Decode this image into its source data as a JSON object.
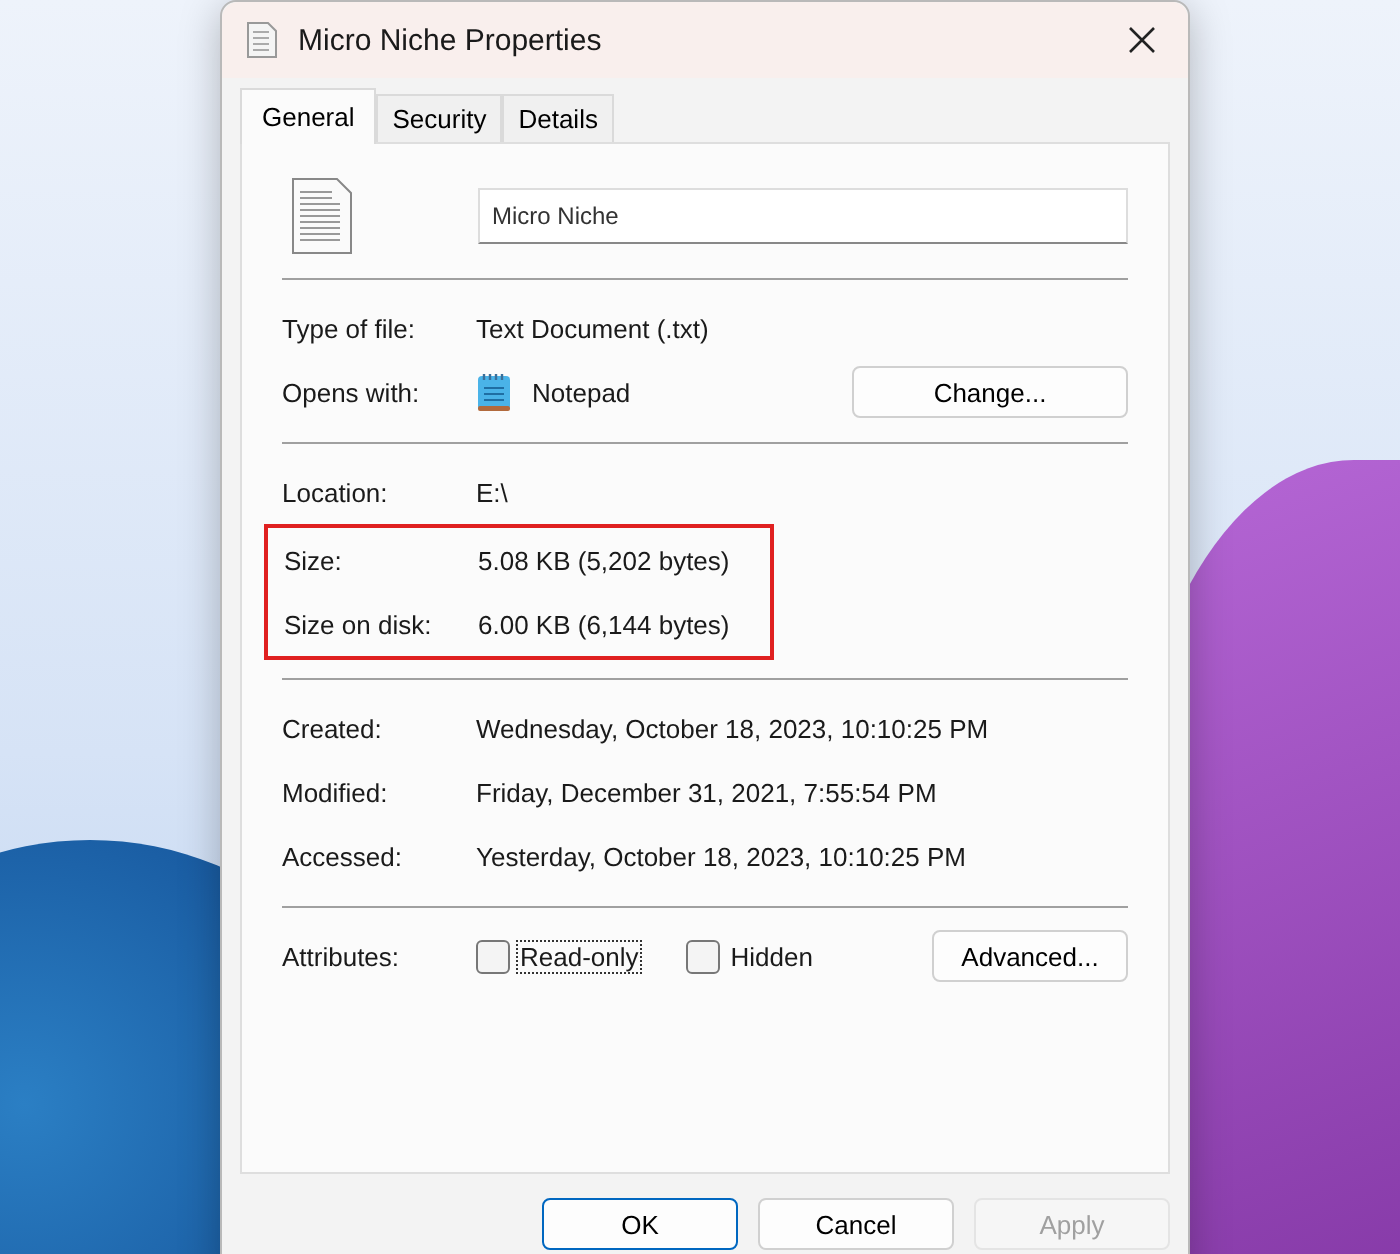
{
  "window": {
    "title": "Micro Niche Properties"
  },
  "tabs": [
    {
      "label": "General",
      "selected": true
    },
    {
      "label": "Security",
      "selected": false
    },
    {
      "label": "Details",
      "selected": false
    }
  ],
  "file_name": {
    "value": "Micro Niche"
  },
  "type_rows": [
    {
      "label": "Type of file:",
      "value": "Text Document (.txt)"
    }
  ],
  "opens_with": {
    "label": "Opens with:",
    "app": "Notepad",
    "button": "Change..."
  },
  "location_rows": [
    {
      "label": "Location:",
      "value": "E:\\"
    }
  ],
  "size_group": {
    "highlighted": true,
    "rows": [
      {
        "label": "Size:",
        "value": "5.08 KB (5,202 bytes)"
      },
      {
        "label": "Size on disk:",
        "value": "6.00 KB (6,144 bytes)"
      }
    ]
  },
  "date_rows": [
    {
      "label": "Created:",
      "value": "Wednesday, October 18, 2023, 10:10:25 PM"
    },
    {
      "label": "Modified:",
      "value": "Friday, December 31, 2021, 7:55:54 PM"
    },
    {
      "label": "Accessed:",
      "value": "Yesterday, October 18, 2023, 10:10:25 PM"
    }
  ],
  "attributes": {
    "label": "Attributes:",
    "checkboxes": [
      {
        "label": "Read-only",
        "checked": false,
        "focused": true
      },
      {
        "label": "Hidden",
        "checked": false,
        "focused": false
      }
    ],
    "button": "Advanced..."
  },
  "buttons": [
    {
      "label": "OK",
      "default": true,
      "disabled": false
    },
    {
      "label": "Cancel",
      "default": false,
      "disabled": false
    },
    {
      "label": "Apply",
      "default": false,
      "disabled": true
    }
  ]
}
